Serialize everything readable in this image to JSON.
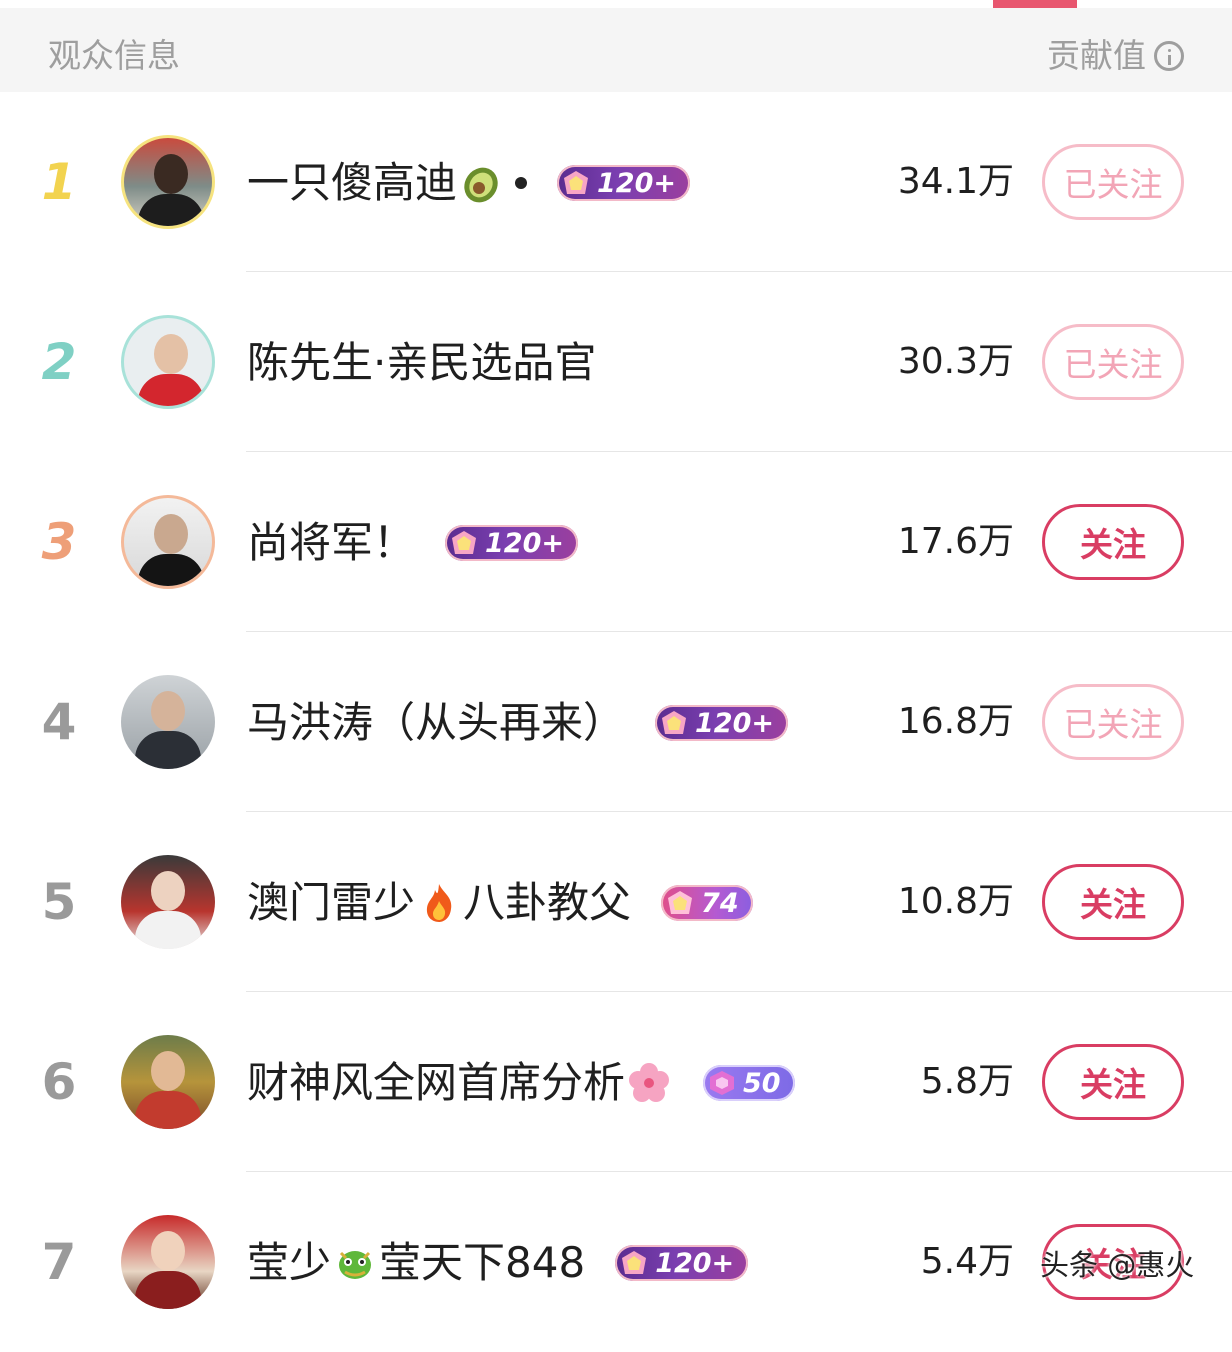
{
  "header": {
    "left_label": "观众信息",
    "right_label": "贡献值",
    "info_icon": "info-circle-icon"
  },
  "colors": {
    "accent": "#e8566f",
    "follow_red": "#d93d63",
    "followed_pink": "#f2a5b6",
    "rank1": "#f2d34f",
    "rank2": "#7fd0c4",
    "rank3": "#ee9f78",
    "rank_other": "#9a9a9a"
  },
  "rows": [
    {
      "rank": "1",
      "name": "一只傻高迪",
      "emoji": "avocado-emoji",
      "extra_dot": true,
      "badge": "120+",
      "value": "34.1万",
      "button": "已关注",
      "followed": true
    },
    {
      "rank": "2",
      "name": "陈先生·亲民选品官",
      "emoji": "",
      "badge": "",
      "value": "30.3万",
      "button": "已关注",
      "followed": true
    },
    {
      "rank": "3",
      "name": "尚将军！",
      "emoji": "",
      "badge": "120+",
      "value": "17.6万",
      "button": "关注",
      "followed": false
    },
    {
      "rank": "4",
      "name": "马洪涛（从头再来）",
      "emoji": "",
      "badge": "120+",
      "value": "16.8万",
      "button": "已关注",
      "followed": true
    },
    {
      "rank": "5",
      "name_a": "澳门雷少",
      "emoji": "fire-emoji",
      "name_b": "八卦教父",
      "badge": "74",
      "value": "10.8万",
      "button": "关注",
      "followed": false
    },
    {
      "rank": "6",
      "name": "财神风全网首席分析",
      "emoji": "cherry-blossom-emoji",
      "badge": "50",
      "value": "5.8万",
      "button": "关注",
      "followed": false
    },
    {
      "rank": "7",
      "name_a": "莹少",
      "emoji": "dragon-emoji",
      "name_b": "莹天下848",
      "badge": "120+",
      "value": "5.4万",
      "button": "关注",
      "followed": false
    }
  ],
  "watermark": "头条 @惠火"
}
